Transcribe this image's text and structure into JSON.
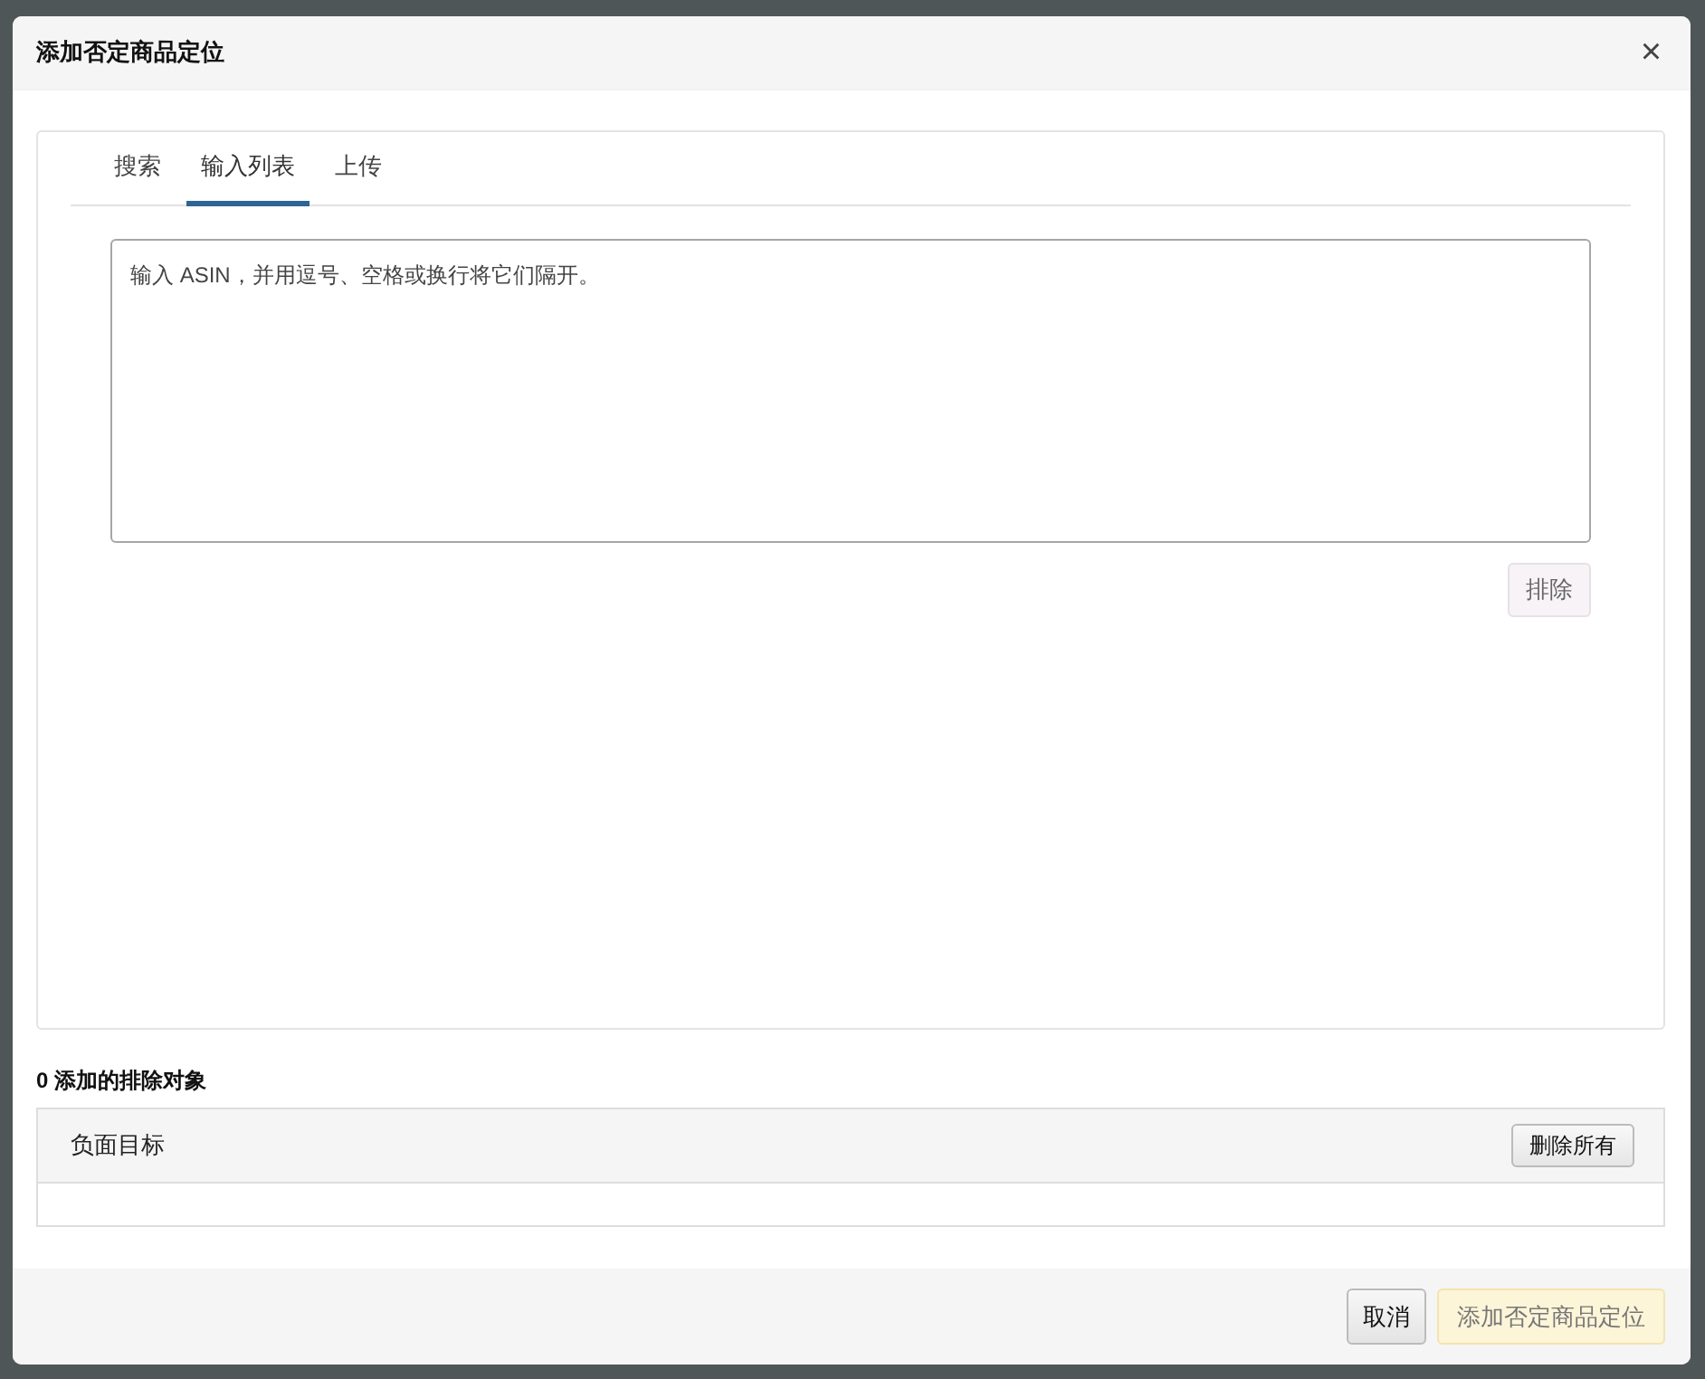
{
  "dialog": {
    "title": "添加否定商品定位",
    "close": "×"
  },
  "tabs": [
    {
      "label": "搜索",
      "selected": false
    },
    {
      "label": "输入列表",
      "selected": true
    },
    {
      "label": "上传",
      "selected": false
    }
  ],
  "asin_input": {
    "placeholder": "输入 ASIN，并用逗号、空格或换行将它们隔开。"
  },
  "exclude_button": {
    "label": "排除",
    "disabled": true
  },
  "added_count": "0 添加的排除对象",
  "table": {
    "columns": [
      "负面目标"
    ],
    "remove_all": "删除所有"
  },
  "footer": {
    "cancel": "取消",
    "submit": {
      "label": "添加否定商品定位",
      "disabled": true
    }
  }
}
